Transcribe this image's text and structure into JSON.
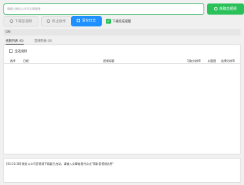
{
  "url_bar": {
    "placeholder": "请输入微信公众号文章链接",
    "fetch_label": "获取音视频"
  },
  "toolbar": {
    "download_label": "下载音视频",
    "stop_label": "停止操作",
    "clear_label": "清空日志",
    "checkbox_label": "下载完成提醒",
    "checkbox_checked": true
  },
  "status": "ON",
  "tabs": [
    {
      "label": "视频列表 (0)",
      "active": true
    },
    {
      "label": "音频列表 (0)",
      "active": false
    }
  ],
  "panel": {
    "select_all_label": "全选视频",
    "columns": [
      "选择",
      "日期",
      "视频标题",
      "可取分辨率",
      "封面图",
      "选择分辨率"
    ]
  },
  "log": {
    "lines": [
      "[05:10:38] 微信公众号音视频下载器已启动，请输入文章链接并点击\"获取音视频信息\""
    ]
  }
}
